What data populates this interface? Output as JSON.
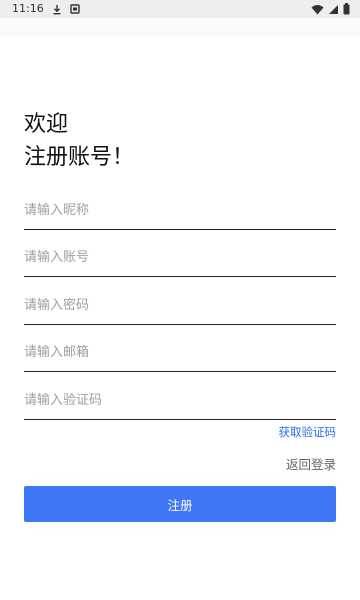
{
  "status_bar": {
    "time": "11:16",
    "left_icons": [
      "download-icon",
      "notification-icon"
    ],
    "right_icons": [
      "wifi-icon",
      "signal-icon",
      "battery-icon"
    ]
  },
  "title": {
    "line1": "欢迎",
    "line2": "注册账号！"
  },
  "form": {
    "nickname": {
      "placeholder": "请输入昵称",
      "value": ""
    },
    "account": {
      "placeholder": "请输入账号",
      "value": ""
    },
    "password": {
      "placeholder": "请输入密码",
      "value": ""
    },
    "email": {
      "placeholder": "请输入邮箱",
      "value": ""
    },
    "code": {
      "placeholder": "请输入验证码",
      "value": ""
    }
  },
  "links": {
    "get_code": "获取验证码",
    "back_login": "返回登录"
  },
  "button": {
    "register": "注册"
  },
  "colors": {
    "accent": "#3f77f6",
    "link": "#2a6df4",
    "underline": "#222222"
  }
}
